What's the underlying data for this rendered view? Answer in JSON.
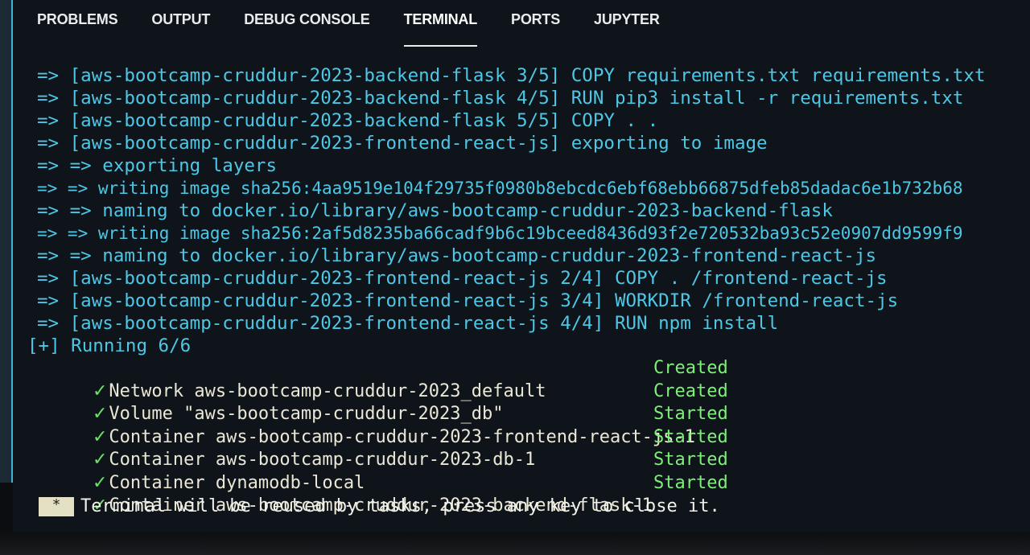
{
  "tabs": [
    {
      "label": "PROBLEMS",
      "active": false
    },
    {
      "label": "OUTPUT",
      "active": false
    },
    {
      "label": "DEBUG CONSOLE",
      "active": false
    },
    {
      "label": "TERMINAL",
      "active": true
    },
    {
      "label": "PORTS",
      "active": false
    },
    {
      "label": "JUPYTER",
      "active": false
    }
  ],
  "terminal": {
    "lines": [
      "=> [aws-bootcamp-cruddur-2023-backend-flask 3/5] COPY requirements.txt requirements.txt",
      "=> [aws-bootcamp-cruddur-2023-backend-flask 4/5] RUN pip3 install -r requirements.txt",
      "=> [aws-bootcamp-cruddur-2023-backend-flask 5/5] COPY . .",
      "=> [aws-bootcamp-cruddur-2023-frontend-react-js] exporting to image",
      "=> => exporting layers",
      "=> => writing image sha256:4aa9519e104f29735f0980b8ebcdc6ebf68ebb66875dfeb85dadac6e1b732b68",
      "=> => naming to docker.io/library/aws-bootcamp-cruddur-2023-backend-flask",
      "=> => writing image sha256:2af5d8235ba66cadf9b6c19bceed8436d93f2e720532ba93c52e0907dd9599f9",
      "=> => naming to docker.io/library/aws-bootcamp-cruddur-2023-frontend-react-js",
      "=> [aws-bootcamp-cruddur-2023-frontend-react-js 2/4] COPY . /frontend-react-js",
      "=> [aws-bootcamp-cruddur-2023-frontend-react-js 3/4] WORKDIR /frontend-react-js",
      "=> [aws-bootcamp-cruddur-2023-frontend-react-js 4/4] RUN npm install"
    ],
    "running": "[+] Running 6/6",
    "check_glyph": "✓",
    "items": [
      {
        "text": "Network aws-bootcamp-cruddur-2023_default",
        "status": "Created"
      },
      {
        "text": "Volume \"aws-bootcamp-cruddur-2023_db\"",
        "status": "Created"
      },
      {
        "text": "Container aws-bootcamp-cruddur-2023-frontend-react-js-1",
        "status": "Started"
      },
      {
        "text": "Container aws-bootcamp-cruddur-2023-db-1",
        "status": "Started"
      },
      {
        "text": "Container dynamodb-local",
        "status": "Started"
      },
      {
        "text": "Container aws-bootcamp-cruddur-2023-backend-flask-1",
        "status": "Started"
      }
    ],
    "reuse_marker": "*",
    "reuse_message": "Terminal will be reused by tasks, press any key to close it."
  },
  "colors": {
    "line_cyan": "#4ec7e6",
    "status_green": "#7ef07a",
    "check_green": "#6ee06a"
  }
}
